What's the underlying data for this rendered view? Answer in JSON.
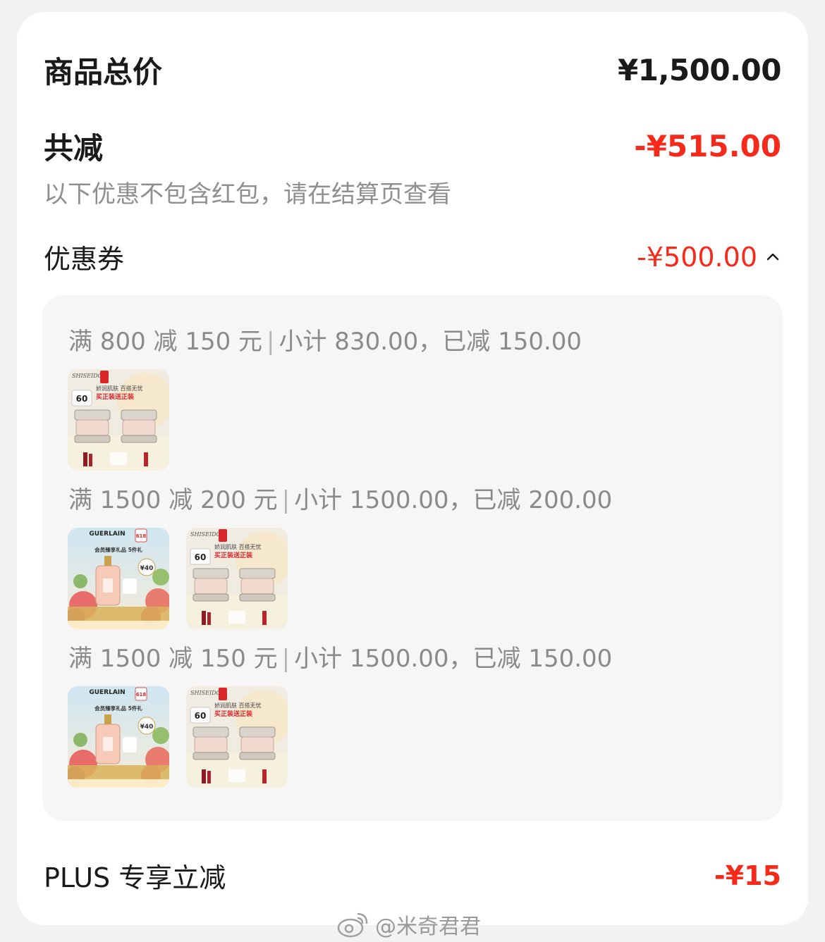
{
  "summary": {
    "total_label": "商品总价",
    "total_value": "¥1,500.00",
    "discount_label": "共减",
    "discount_value": "-¥515.00",
    "note": "以下优惠不包含红包，请在结算页查看"
  },
  "coupon": {
    "label": "优惠券",
    "value": "-¥500.00",
    "expanded": true,
    "groups": [
      {
        "rule": "满 800 减 150 元",
        "subtotal": "小计 830.00，已减 150.00",
        "products": [
          {
            "brand": "SHISEIDO",
            "headline": "娇润肌肤 百搭无忧",
            "promo": "买正装送正装",
            "badge": "60"
          }
        ]
      },
      {
        "rule": "满 1500 减 200 元",
        "subtotal": "小计 1500.00，已减 200.00",
        "products": [
          {
            "brand": "GUERLAIN",
            "headline": "会员臻享礼品 5件礼",
            "promo": "¥40",
            "badge": "618"
          },
          {
            "brand": "SHISEIDO",
            "headline": "娇润肌肤 百搭无忧",
            "promo": "买正装送正装",
            "badge": "60"
          }
        ]
      },
      {
        "rule": "满 1500 减 150 元",
        "subtotal": "小计 1500.00，已减 150.00",
        "products": [
          {
            "brand": "GUERLAIN",
            "headline": "会员臻享礼品 5件礼",
            "promo": "¥40",
            "badge": "618"
          },
          {
            "brand": "SHISEIDO",
            "headline": "娇润肌肤 百搭无忧",
            "promo": "买正装送正装",
            "badge": "60"
          }
        ]
      }
    ]
  },
  "plus": {
    "label": "PLUS 专享立减",
    "value": "-¥15"
  },
  "watermark": "@米奇君君",
  "colors": {
    "accent_red": "#f52a1b",
    "text_dark": "#1a1a1a",
    "text_gray": "#8a8a8a",
    "panel_bg": "#f6f6f6"
  },
  "icons": {
    "coupon_toggle": "chevron-up-icon",
    "watermark": "weibo-icon"
  }
}
